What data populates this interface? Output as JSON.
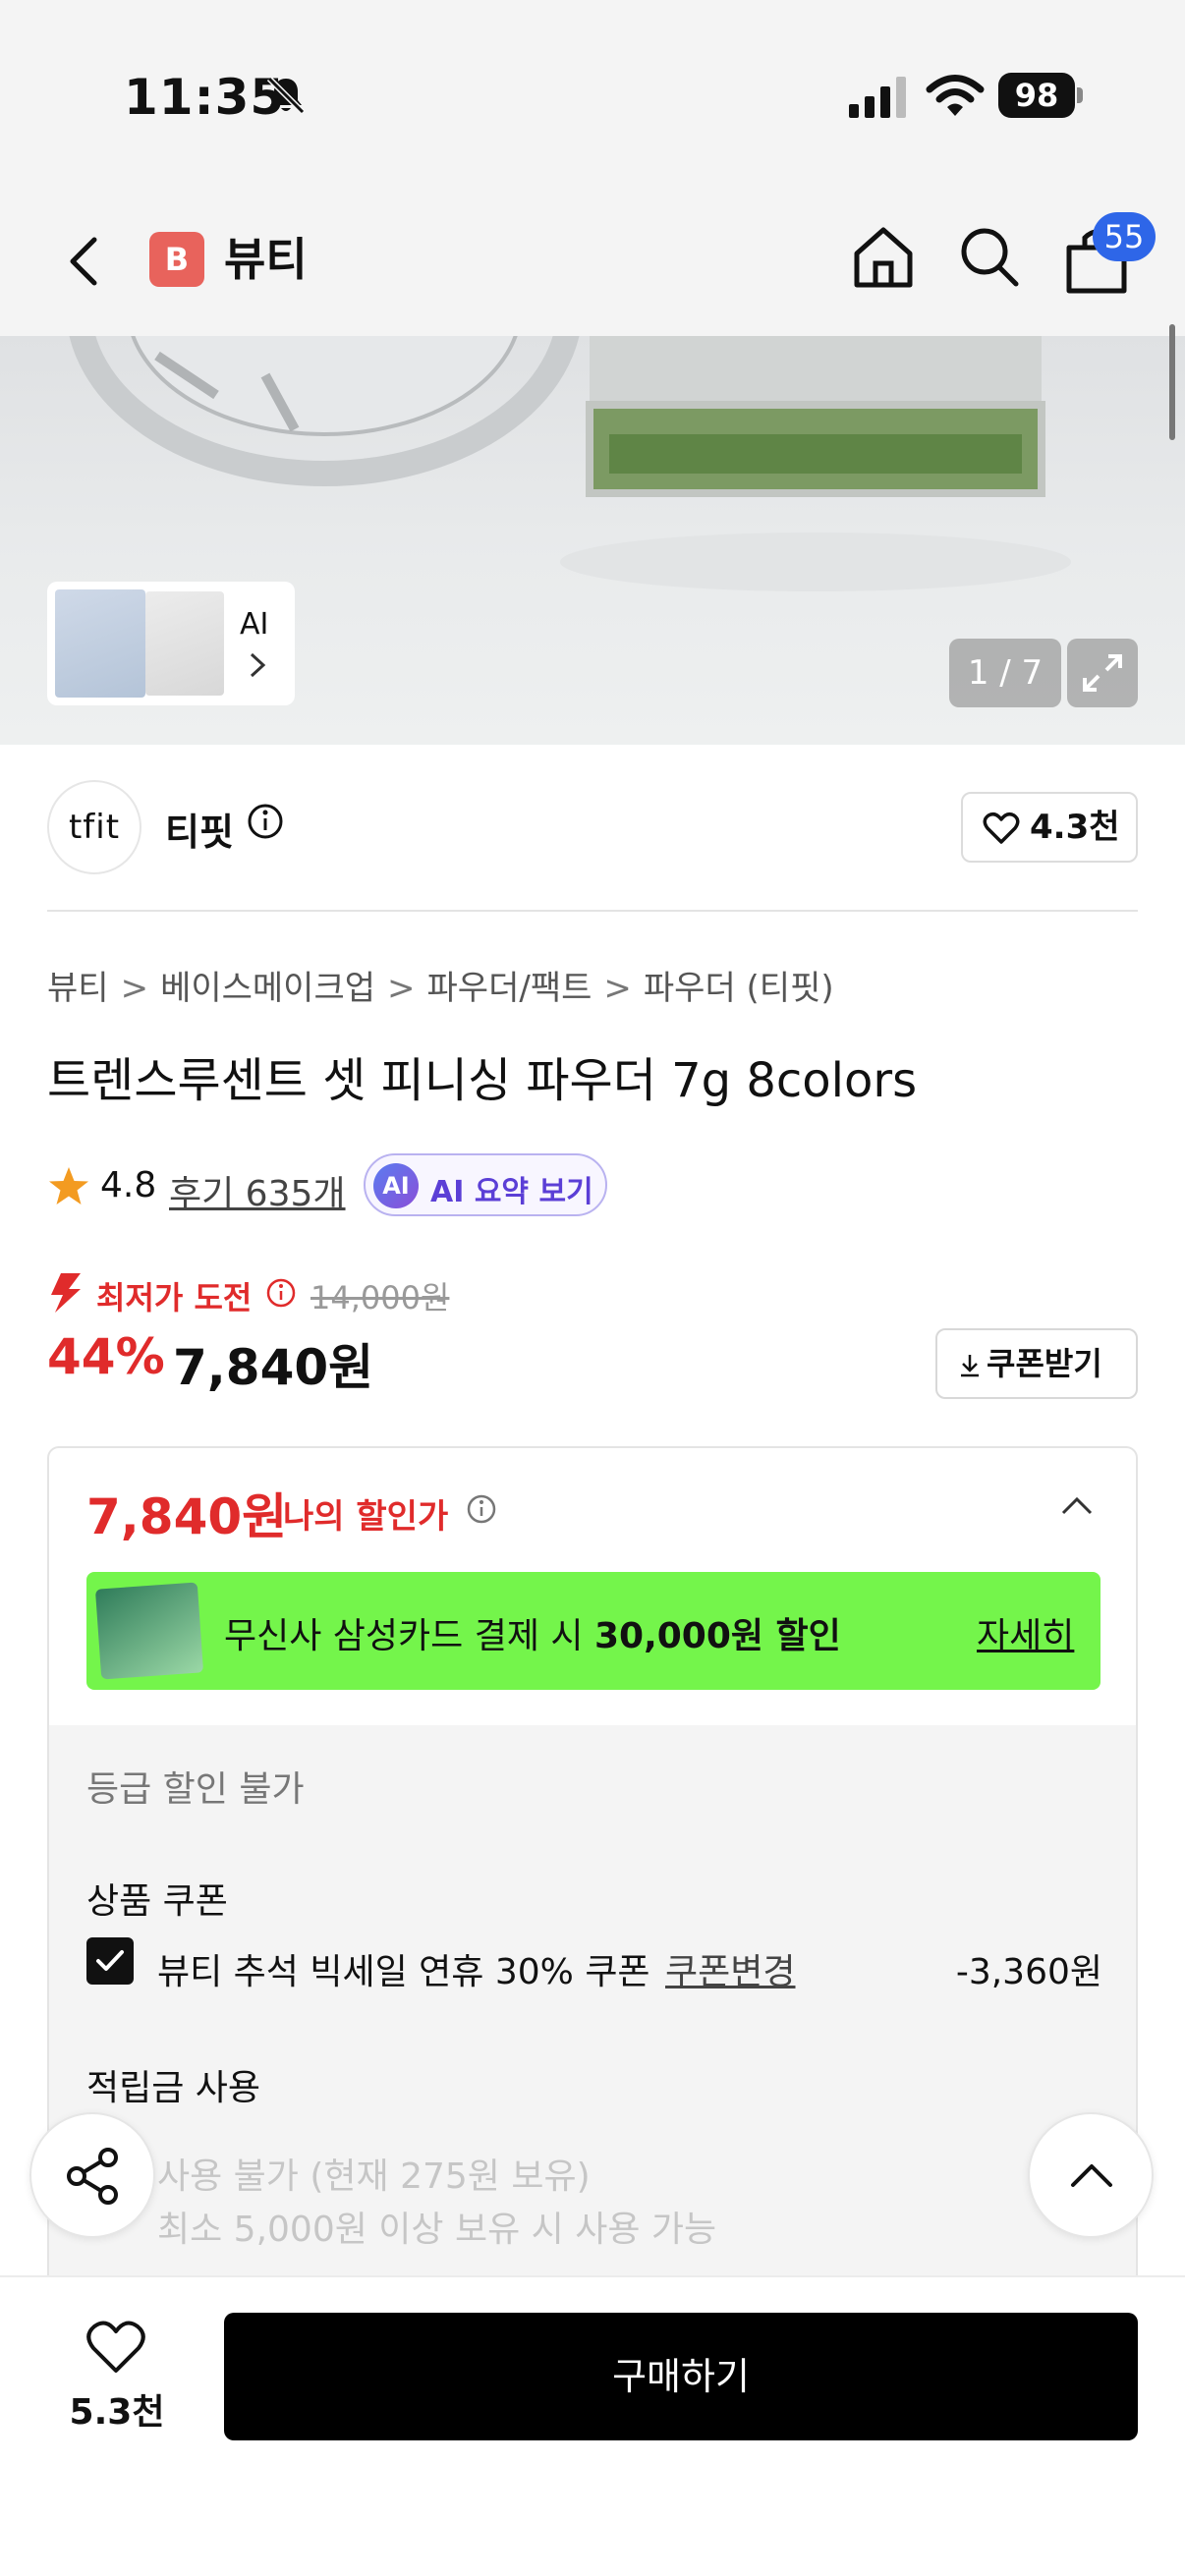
{
  "status_bar": {
    "time": "11:35",
    "battery": "98"
  },
  "nav": {
    "brand_badge": "B",
    "brand_name": "뷰티",
    "cart_count": "55"
  },
  "gallery": {
    "thumb_label": "AI",
    "counter": "1 / 7"
  },
  "seller": {
    "logo_text": "tfit",
    "name": "티핏",
    "like_count": "4.3천"
  },
  "breadcrumb": [
    "뷰티",
    "베이스메이크업",
    "파우더/팩트",
    "파우더 (티핏)"
  ],
  "product": {
    "title": "트렌스루센트 셋 피니싱 파우더 7g 8colors",
    "rating": "4.8",
    "review_text": "후기 635개",
    "ai_badge": "AI",
    "ai_summary": "AI 요약 보기"
  },
  "pricing": {
    "lowest_label": "최저가 도전",
    "original_price": "14,000원",
    "discount": "44%",
    "price": "7,840원",
    "coupon_button": "쿠폰받기"
  },
  "my_discount": {
    "price": "7,840원",
    "label": "나의 할인가",
    "card_banner_prefix": "무신사 삼성카드 결제 시 ",
    "card_banner_bold": "30,000원 할인",
    "card_banner_more": "자세히",
    "grade_note": "등급 할인 불가",
    "coupon_section": "상품 쿠폰",
    "coupon_name": "뷰티 추석 빅세일 연휴 30% 쿠폰",
    "coupon_change": "쿠폰변경",
    "coupon_amount": "-3,360원",
    "points_section": "적립금 사용",
    "points_line1": "사용 불가 (현재 275원 보유)",
    "points_line2": "최소 5,000원 이상 보유 시 사용 가능"
  },
  "bottom": {
    "like_count": "5.3천",
    "buy_label": "구매하기"
  },
  "colors": {
    "accent_red": "#e02b2b",
    "banner_green": "#74f54b",
    "badge_blue": "#2e66e8",
    "brand_badge": "#e8635c"
  }
}
